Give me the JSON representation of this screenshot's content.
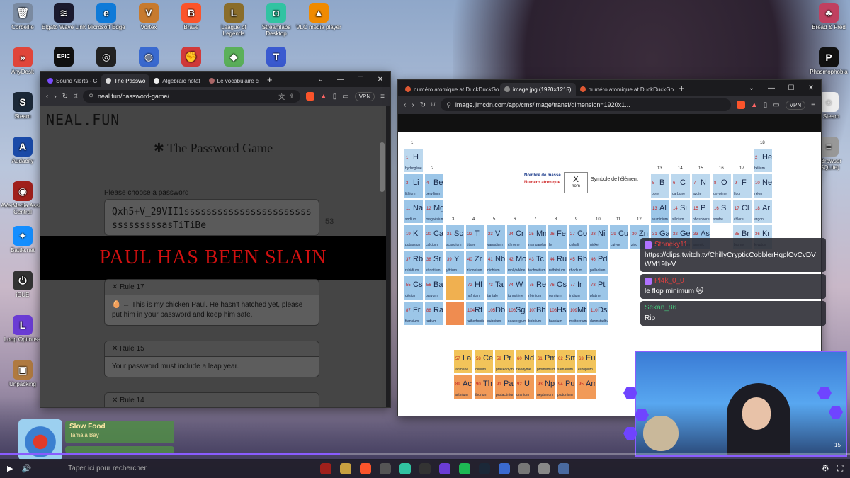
{
  "desktop": {
    "icons_left": [
      {
        "label": "Corbeille",
        "glyph": "🗑",
        "color": "#7a8aa0"
      },
      {
        "label": "AnyDesk",
        "glyph": "»",
        "color": "#e0453a"
      },
      {
        "label": "Steam",
        "glyph": "S",
        "color": "#1b2838"
      },
      {
        "label": "Audacity",
        "glyph": "A",
        "color": "#1a4aa8"
      },
      {
        "label": "AVerMedia Assist Central",
        "glyph": "◉",
        "color": "#a0201c"
      },
      {
        "label": "Battle.net",
        "glyph": "✦",
        "color": "#148eff"
      },
      {
        "label": "iCUE",
        "glyph": "⏻",
        "color": "#333"
      },
      {
        "label": "Loop Options+",
        "glyph": "L",
        "color": "#6a3cd4"
      },
      {
        "label": "Unpacking",
        "glyph": "▣",
        "color": "#b07a40"
      }
    ],
    "icons_top": [
      {
        "label": "Elgato Wave Link",
        "glyph": "≋",
        "color": "#1a1a2e"
      },
      {
        "label": "Microsoft Edge",
        "glyph": "e",
        "color": "#0f7ad8"
      },
      {
        "label": "Vortex",
        "glyph": "V",
        "color": "#c77a2e"
      },
      {
        "label": "Brave",
        "glyph": "B",
        "color": "#fb542b"
      },
      {
        "label": "League of Legends",
        "glyph": "L",
        "color": "#8a6d2a"
      },
      {
        "label": "Streamlabs Desktop",
        "glyph": "◘",
        "color": "#31c3a2"
      },
      {
        "label": "VLC media player",
        "glyph": "▲",
        "color": "#f08a00"
      }
    ],
    "icons_row2": [
      {
        "label": "",
        "glyph": "EPIC",
        "color": "#111"
      },
      {
        "label": "",
        "glyph": "◎",
        "color": "#222"
      },
      {
        "label": "",
        "glyph": "◍",
        "color": "#3a6ad0"
      },
      {
        "label": "",
        "glyph": "✊",
        "color": "#d23a3a"
      },
      {
        "label": "",
        "glyph": "◆",
        "color": "#5bb05a"
      },
      {
        "label": "",
        "glyph": "T",
        "color": "#3a5ad0"
      }
    ],
    "icons_right": [
      {
        "label": "Bread & Fred",
        "glyph": "♣",
        "color": "#c04060"
      },
      {
        "label": "Phasmophobia",
        "glyph": "P",
        "color": "#111"
      },
      {
        "label": "...Steam",
        "glyph": "◌",
        "color": "#eee"
      },
      {
        "label": "...Browser (SQLite)",
        "glyph": "≡",
        "color": "#999"
      }
    ]
  },
  "left_browser": {
    "tabs": [
      {
        "label": "Sound Alerts - C",
        "fav": "#7a4cff"
      },
      {
        "label": "The Passwo",
        "fav": "#ddd",
        "active": true
      },
      {
        "label": "Algebraic notat",
        "fav": "#eee"
      },
      {
        "label": "Le vocabulaire c",
        "fav": "#a66"
      }
    ],
    "url": "neal.fun/password-game/",
    "vpn": "VPN",
    "page": {
      "logo": "NEAL.FUN",
      "title": "✱ The Password Game",
      "label": "Please choose a password",
      "password": "Qxh5+V_29VII1ssssssssssssssssssssssssssssssssasTiTiBe",
      "count": "53",
      "banner": "PAUL HAS BEEN SLAIN",
      "rules": [
        {
          "head": "✕ Rule 17",
          "body": "🥚 ← This is my chicken Paul. He hasn't hatched yet, please put him in your password and keep him safe."
        },
        {
          "head": "✕ Rule 15",
          "body": "Your password must include a leap year."
        },
        {
          "head": "✕ Rule 14",
          "body": ""
        }
      ]
    }
  },
  "right_browser": {
    "tabs": [
      {
        "label": "numéro atomique at DuckDuckGo",
        "fav": "#de5833"
      },
      {
        "label": "image.jpg (1920×1215)",
        "fav": "#888",
        "active": true
      },
      {
        "label": "numéro atomique at DuckDuckGo",
        "fav": "#de5833"
      }
    ],
    "url": "image.jimcdn.com/app/cms/image/transf/dimension=1920x1...",
    "vpn": "VPN",
    "table": {
      "legend_mass": "Nombre de masse",
      "legend_number": "Numéro atomique",
      "legend_symbol": "Symbole de l'élément",
      "legend_name": "nom",
      "legend_x": "X",
      "elements": [
        {
          "n": "1",
          "s": "H",
          "name": "hydrogène",
          "c": "#bcd8ee",
          "col": 1,
          "row": 1
        },
        {
          "n": "2",
          "s": "He",
          "name": "hélium",
          "c": "#bcd8ee",
          "col": 18,
          "row": 1
        },
        {
          "n": "3",
          "s": "Li",
          "name": "lithium",
          "c": "#9cc6e8",
          "col": 1,
          "row": 2
        },
        {
          "n": "4",
          "s": "Be",
          "name": "béryllium",
          "c": "#9cc6e8",
          "col": 2,
          "row": 2
        },
        {
          "n": "5",
          "s": "B",
          "name": "bore",
          "c": "#bcd8ee",
          "col": 13,
          "row": 2
        },
        {
          "n": "6",
          "s": "C",
          "name": "carbone",
          "c": "#bcd8ee",
          "col": 14,
          "row": 2
        },
        {
          "n": "7",
          "s": "N",
          "name": "azote",
          "c": "#bcd8ee",
          "col": 15,
          "row": 2
        },
        {
          "n": "8",
          "s": "O",
          "name": "oxygène",
          "c": "#bcd8ee",
          "col": 16,
          "row": 2
        },
        {
          "n": "9",
          "s": "F",
          "name": "fluor",
          "c": "#bcd8ee",
          "col": 17,
          "row": 2
        },
        {
          "n": "10",
          "s": "Ne",
          "name": "néon",
          "c": "#bcd8ee",
          "col": 18,
          "row": 2
        },
        {
          "n": "11",
          "s": "Na",
          "name": "sodium",
          "c": "#9cc6e8",
          "col": 1,
          "row": 3
        },
        {
          "n": "12",
          "s": "Mg",
          "name": "magnésium",
          "c": "#9cc6e8",
          "col": 2,
          "row": 3
        },
        {
          "n": "13",
          "s": "Al",
          "name": "aluminium",
          "c": "#9cc6e8",
          "col": 13,
          "row": 3
        },
        {
          "n": "14",
          "s": "Si",
          "name": "silicium",
          "c": "#bcd8ee",
          "col": 14,
          "row": 3
        },
        {
          "n": "15",
          "s": "P",
          "name": "phosphore",
          "c": "#bcd8ee",
          "col": 15,
          "row": 3
        },
        {
          "n": "16",
          "s": "S",
          "name": "soufre",
          "c": "#bcd8ee",
          "col": 16,
          "row": 3
        },
        {
          "n": "17",
          "s": "Cl",
          "name": "chlore",
          "c": "#bcd8ee",
          "col": 17,
          "row": 3
        },
        {
          "n": "18",
          "s": "Ar",
          "name": "argon",
          "c": "#bcd8ee",
          "col": 18,
          "row": 3
        },
        {
          "n": "19",
          "s": "K",
          "name": "potassium",
          "c": "#9cc6e8",
          "col": 1,
          "row": 4
        },
        {
          "n": "20",
          "s": "Ca",
          "name": "calcium",
          "c": "#9cc6e8",
          "col": 2,
          "row": 4
        },
        {
          "n": "21",
          "s": "Sc",
          "name": "scandium",
          "c": "#9cc6e8",
          "col": 3,
          "row": 4
        },
        {
          "n": "22",
          "s": "Ti",
          "name": "titane",
          "c": "#9cc6e8",
          "col": 4,
          "row": 4
        },
        {
          "n": "23",
          "s": "V",
          "name": "vanadium",
          "c": "#9cc6e8",
          "col": 5,
          "row": 4
        },
        {
          "n": "24",
          "s": "Cr",
          "name": "chrome",
          "c": "#9cc6e8",
          "col": 6,
          "row": 4
        },
        {
          "n": "25",
          "s": "Mn",
          "name": "manganèse",
          "c": "#9cc6e8",
          "col": 7,
          "row": 4
        },
        {
          "n": "26",
          "s": "Fe",
          "name": "fer",
          "c": "#9cc6e8",
          "col": 8,
          "row": 4
        },
        {
          "n": "27",
          "s": "Co",
          "name": "cobalt",
          "c": "#9cc6e8",
          "col": 9,
          "row": 4
        },
        {
          "n": "28",
          "s": "Ni",
          "name": "nickel",
          "c": "#9cc6e8",
          "col": 10,
          "row": 4
        },
        {
          "n": "29",
          "s": "Cu",
          "name": "cuivre",
          "c": "#9cc6e8",
          "col": 11,
          "row": 4
        },
        {
          "n": "30",
          "s": "Zn",
          "name": "zinc",
          "c": "#9cc6e8",
          "col": 12,
          "row": 4
        },
        {
          "n": "31",
          "s": "Ga",
          "name": "gallium",
          "c": "#9cc6e8",
          "col": 13,
          "row": 4
        },
        {
          "n": "32",
          "s": "Ge",
          "name": "germanium",
          "c": "#9cc6e8",
          "col": 14,
          "row": 4
        },
        {
          "n": "33",
          "s": "As",
          "name": "arsenic",
          "c": "#9cc6e8",
          "col": 15,
          "row": 4
        },
        {
          "n": "35",
          "s": "Br",
          "name": "brome",
          "c": "#bcd8ee",
          "col": 17,
          "row": 4
        },
        {
          "n": "36",
          "s": "Kr",
          "name": "krypton",
          "c": "#bcd8ee",
          "col": 18,
          "row": 4
        },
        {
          "n": "37",
          "s": "Rb",
          "name": "rubidium",
          "c": "#9cc6e8",
          "col": 1,
          "row": 5
        },
        {
          "n": "38",
          "s": "Sr",
          "name": "strontium",
          "c": "#9cc6e8",
          "col": 2,
          "row": 5
        },
        {
          "n": "39",
          "s": "Y",
          "name": "yttrium",
          "c": "#9cc6e8",
          "col": 3,
          "row": 5
        },
        {
          "n": "40",
          "s": "Zr",
          "name": "zirconium",
          "c": "#9cc6e8",
          "col": 4,
          "row": 5
        },
        {
          "n": "41",
          "s": "Nb",
          "name": "niobium",
          "c": "#9cc6e8",
          "col": 5,
          "row": 5
        },
        {
          "n": "42",
          "s": "Mo",
          "name": "molybdène",
          "c": "#9cc6e8",
          "col": 6,
          "row": 5
        },
        {
          "n": "43",
          "s": "Tc",
          "name": "technétium",
          "c": "#9cc6e8",
          "col": 7,
          "row": 5
        },
        {
          "n": "44",
          "s": "Ru",
          "name": "ruthénium",
          "c": "#9cc6e8",
          "col": 8,
          "row": 5
        },
        {
          "n": "45",
          "s": "Rh",
          "name": "rhodium",
          "c": "#9cc6e8",
          "col": 9,
          "row": 5
        },
        {
          "n": "46",
          "s": "Pd",
          "name": "palladium",
          "c": "#9cc6e8",
          "col": 10,
          "row": 5
        },
        {
          "n": "55",
          "s": "Cs",
          "name": "césium",
          "c": "#9cc6e8",
          "col": 1,
          "row": 6
        },
        {
          "n": "56",
          "s": "Ba",
          "name": "baryum",
          "c": "#9cc6e8",
          "col": 2,
          "row": 6
        },
        {
          "n": "",
          "s": "",
          "name": "",
          "c": "#f0b050",
          "col": 3,
          "row": 6
        },
        {
          "n": "72",
          "s": "Hf",
          "name": "hafnium",
          "c": "#9cc6e8",
          "col": 4,
          "row": 6
        },
        {
          "n": "73",
          "s": "Ta",
          "name": "tantale",
          "c": "#9cc6e8",
          "col": 5,
          "row": 6
        },
        {
          "n": "74",
          "s": "W",
          "name": "tungstène",
          "c": "#9cc6e8",
          "col": 6,
          "row": 6
        },
        {
          "n": "75",
          "s": "Re",
          "name": "rhénium",
          "c": "#9cc6e8",
          "col": 7,
          "row": 6
        },
        {
          "n": "76",
          "s": "Os",
          "name": "osmium",
          "c": "#9cc6e8",
          "col": 8,
          "row": 6
        },
        {
          "n": "77",
          "s": "Ir",
          "name": "iridium",
          "c": "#9cc6e8",
          "col": 9,
          "row": 6
        },
        {
          "n": "78",
          "s": "Pt",
          "name": "platine",
          "c": "#9cc6e8",
          "col": 10,
          "row": 6
        },
        {
          "n": "87",
          "s": "Fr",
          "name": "francium",
          "c": "#9cc6e8",
          "col": 1,
          "row": 7
        },
        {
          "n": "88",
          "s": "Ra",
          "name": "radium",
          "c": "#9cc6e8",
          "col": 2,
          "row": 7
        },
        {
          "n": "",
          "s": "",
          "name": "",
          "c": "#ef8c50",
          "col": 3,
          "row": 7
        },
        {
          "n": "104",
          "s": "Rf",
          "name": "rutherfordium",
          "c": "#9cc6e8",
          "col": 4,
          "row": 7
        },
        {
          "n": "105",
          "s": "Db",
          "name": "dubnium",
          "c": "#9cc6e8",
          "col": 5,
          "row": 7
        },
        {
          "n": "106",
          "s": "Sg",
          "name": "seaborgium",
          "c": "#9cc6e8",
          "col": 6,
          "row": 7
        },
        {
          "n": "107",
          "s": "Bh",
          "name": "bohrium",
          "c": "#9cc6e8",
          "col": 7,
          "row": 7
        },
        {
          "n": "108",
          "s": "Hs",
          "name": "hassium",
          "c": "#9cc6e8",
          "col": 8,
          "row": 7
        },
        {
          "n": "109",
          "s": "Mt",
          "name": "meitnerium",
          "c": "#9cc6e8",
          "col": 9,
          "row": 7
        },
        {
          "n": "110",
          "s": "Ds",
          "name": "darmstadtium",
          "c": "#9cc6e8",
          "col": 10,
          "row": 7
        }
      ],
      "lanthanides": [
        {
          "n": "57",
          "s": "La",
          "name": "lanthane"
        },
        {
          "n": "58",
          "s": "Ce",
          "name": "cérium"
        },
        {
          "n": "59",
          "s": "Pr",
          "name": "praséodyme"
        },
        {
          "n": "60",
          "s": "Nd",
          "name": "néodyme"
        },
        {
          "n": "61",
          "s": "Pm",
          "name": "prométhium"
        },
        {
          "n": "62",
          "s": "Sm",
          "name": "samarium"
        },
        {
          "n": "63",
          "s": "Eu",
          "name": "europium"
        }
      ],
      "actinides": [
        {
          "n": "89",
          "s": "Ac",
          "name": "actinium"
        },
        {
          "n": "90",
          "s": "Th",
          "name": "thorium"
        },
        {
          "n": "91",
          "s": "Pa",
          "name": "protactinium"
        },
        {
          "n": "92",
          "s": "U",
          "name": "uranium"
        },
        {
          "n": "93",
          "s": "Np",
          "name": "neptunium"
        },
        {
          "n": "94",
          "s": "Pu",
          "name": "plutonium"
        },
        {
          "n": "95",
          "s": "Am",
          "name": ""
        }
      ],
      "group_labels": [
        {
          "t": "1",
          "col": 1,
          "row": 0
        },
        {
          "t": "2",
          "col": 2,
          "row": 1
        },
        {
          "t": "3",
          "col": 3,
          "row": 3
        },
        {
          "t": "4",
          "col": 4,
          "row": 3
        },
        {
          "t": "5",
          "col": 5,
          "row": 3
        },
        {
          "t": "6",
          "col": 6,
          "row": 3
        },
        {
          "t": "7",
          "col": 7,
          "row": 3
        },
        {
          "t": "8",
          "col": 8,
          "row": 3
        },
        {
          "t": "9",
          "col": 9,
          "row": 3
        },
        {
          "t": "10",
          "col": 10,
          "row": 3
        },
        {
          "t": "11",
          "col": 11,
          "row": 3
        },
        {
          "t": "12",
          "col": 12,
          "row": 3
        },
        {
          "t": "13",
          "col": 13,
          "row": 1
        },
        {
          "t": "14",
          "col": 14,
          "row": 1
        },
        {
          "t": "15",
          "col": 15,
          "row": 1
        },
        {
          "t": "16",
          "col": 16,
          "row": 1
        },
        {
          "t": "17",
          "col": 17,
          "row": 1
        },
        {
          "t": "18",
          "col": 18,
          "row": 0
        }
      ]
    }
  },
  "chat": {
    "messages": [
      {
        "user": "Stoneky11",
        "text": "https://clips.twitch.tv/ChillyCrypticCobblerHqplOvCvDVWM19h-V",
        "badge": true
      },
      {
        "user": "Pl4k_0_0",
        "text": "le flop minimum 🙀",
        "badge": true
      },
      {
        "user": "Sekan_86",
        "text": "Rip",
        "badge": false
      }
    ]
  },
  "music": {
    "song": "Slow Food",
    "artist": "Tamala Bay"
  },
  "taskbar": {
    "search_placeholder": "Taper ici pour rechercher",
    "counter": "15"
  },
  "video_progress": 0.4
}
